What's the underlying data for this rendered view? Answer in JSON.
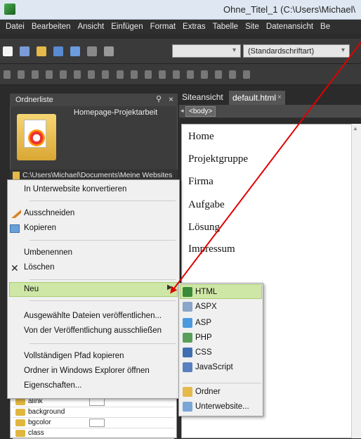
{
  "window": {
    "title": "Ohne_Titel_1 (C:\\Users\\Michael\\"
  },
  "menubar": {
    "items": [
      "Datei",
      "Bearbeiten",
      "Ansicht",
      "Einfügen",
      "Format",
      "Extras",
      "Tabelle",
      "Site",
      "Datenansicht",
      "Be"
    ]
  },
  "toolbar": {
    "font_select": "(Standardschriftart)",
    "style_select": ""
  },
  "folder_panel": {
    "title": "Ordnerliste",
    "folder_name": "Homepage-Projektarbeit",
    "path": "C:\\Users\\Michael\\Documents\\Meine Websites"
  },
  "editor": {
    "tabs": [
      {
        "label": "Siteansicht"
      },
      {
        "label": "default.html"
      }
    ],
    "tag_selector": "<body>",
    "content": [
      "Home",
      "Projektgruppe",
      "Firma",
      "Aufgabe",
      "Lösung",
      "Impressum"
    ]
  },
  "properties": {
    "rows": [
      "alink",
      "background",
      "bgcolor",
      "class"
    ]
  },
  "context_menu": {
    "items": [
      "In Unterwebsite konvertieren",
      "Ausschneiden",
      "Kopieren",
      "Umbenennen",
      "Löschen",
      "Neu",
      "Ausgewählte Dateien veröffentlichen...",
      "Von der Veröffentlichung ausschließen",
      "Vollständigen Pfad kopieren",
      "Ordner in Windows Explorer öffnen",
      "Eigenschaften..."
    ]
  },
  "submenu_new": {
    "items": [
      {
        "label": "HTML",
        "icon": "html-file-icon"
      },
      {
        "label": "ASPX",
        "icon": "aspx-file-icon"
      },
      {
        "label": "ASP",
        "icon": "asp-file-icon"
      },
      {
        "label": "PHP",
        "icon": "php-file-icon"
      },
      {
        "label": "CSS",
        "icon": "css-file-icon"
      },
      {
        "label": "JavaScript",
        "icon": "javascript-file-icon"
      },
      {
        "label": "Ordner",
        "icon": "folder-icon"
      },
      {
        "label": "Unterwebsite...",
        "icon": "subsite-icon"
      }
    ]
  },
  "colors": {
    "highlight": "#cfe7a6",
    "annotation_arrow": "#e00000"
  }
}
